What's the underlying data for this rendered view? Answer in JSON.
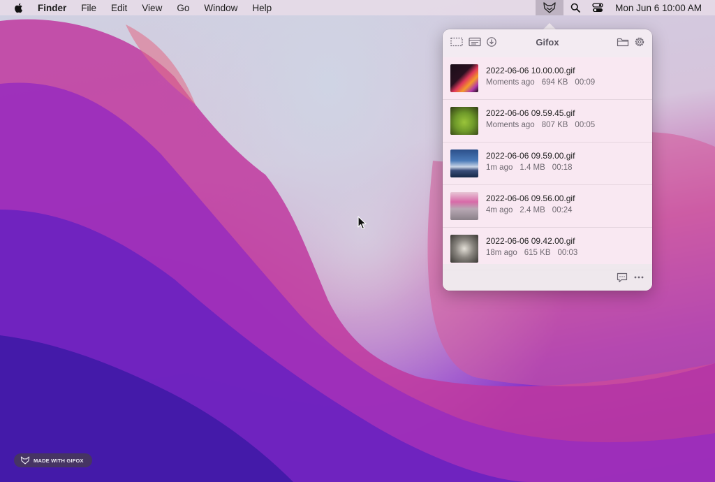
{
  "menubar": {
    "app_name": "Finder",
    "items": [
      "File",
      "Edit",
      "View",
      "Go",
      "Window",
      "Help"
    ],
    "clock": "Mon Jun 6  10:00 AM"
  },
  "popover": {
    "title": "Gifox",
    "recordings": [
      {
        "filename": "2022-06-06 10.00.00.gif",
        "age": "Moments ago",
        "size": "694 KB",
        "duration": "00:09"
      },
      {
        "filename": "2022-06-06 09.59.45.gif",
        "age": "Moments ago",
        "size": "807 KB",
        "duration": "00:05"
      },
      {
        "filename": "2022-06-06 09.59.00.gif",
        "age": "1m ago",
        "size": "1.4 MB",
        "duration": "00:18"
      },
      {
        "filename": "2022-06-06 09.56.00.gif",
        "age": "4m ago",
        "size": "2.4 MB",
        "duration": "00:24"
      },
      {
        "filename": "2022-06-06 09.42.00.gif",
        "age": "18m ago",
        "size": "615 KB",
        "duration": "00:03"
      }
    ]
  },
  "badge": {
    "label": "MADE WITH GIFOX"
  },
  "icons": {
    "menubar": [
      "apple-icon",
      "gifox-status-icon",
      "search-icon",
      "control-center-icon"
    ],
    "header": [
      "capture-area-icon",
      "capture-window-icon",
      "download-icon",
      "folder-icon",
      "gear-icon"
    ],
    "footer": [
      "feedback-icon",
      "more-icon"
    ]
  }
}
